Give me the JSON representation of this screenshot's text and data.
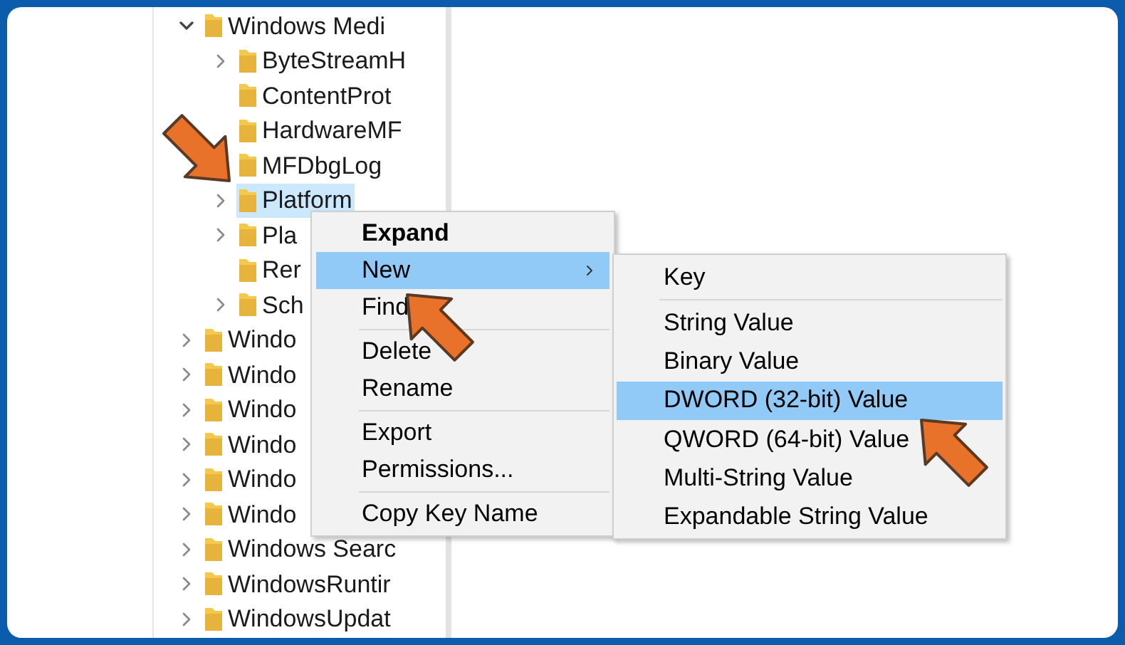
{
  "tree": {
    "items": [
      {
        "label": "Windows Medi",
        "kind": "branch",
        "expanded": true,
        "selected": false,
        "children": [
          {
            "label": "ByteStreamH",
            "kind": "branch",
            "expanded": false,
            "selected": false
          },
          {
            "label": "ContentProt",
            "kind": "leaf",
            "selected": false
          },
          {
            "label": "HardwareMF",
            "kind": "leaf",
            "selected": false
          },
          {
            "label": "MFDbgLog",
            "kind": "leaf",
            "selected": false
          },
          {
            "label": "Platform",
            "kind": "branch",
            "expanded": false,
            "selected": true
          },
          {
            "label": "Pla",
            "kind": "branch",
            "expanded": false,
            "selected": false
          },
          {
            "label": "Rer",
            "kind": "leaf",
            "selected": false
          },
          {
            "label": "Sch",
            "kind": "branch",
            "expanded": false,
            "selected": false
          }
        ]
      },
      {
        "label": "Windo",
        "kind": "branch",
        "expanded": false,
        "selected": false
      },
      {
        "label": "Windo",
        "kind": "branch",
        "expanded": false,
        "selected": false
      },
      {
        "label": "Windo",
        "kind": "branch",
        "expanded": false,
        "selected": false
      },
      {
        "label": "Windo",
        "kind": "branch",
        "expanded": false,
        "selected": false
      },
      {
        "label": "Windo",
        "kind": "branch",
        "expanded": false,
        "selected": false
      },
      {
        "label": "Windo",
        "kind": "branch",
        "expanded": false,
        "selected": false
      },
      {
        "label": "Windows Searc",
        "kind": "branch",
        "expanded": false,
        "selected": false
      },
      {
        "label": "WindowsRuntir",
        "kind": "branch",
        "expanded": false,
        "selected": false
      },
      {
        "label": "WindowsUpdat",
        "kind": "branch",
        "expanded": false,
        "selected": false
      }
    ]
  },
  "context_menu": {
    "items": [
      {
        "kind": "item",
        "label": "Expand",
        "bold": true,
        "selected": false,
        "submenu": false
      },
      {
        "kind": "item",
        "label": "New",
        "bold": false,
        "selected": true,
        "submenu": true
      },
      {
        "kind": "item",
        "label": "Find",
        "bold": false,
        "selected": false,
        "submenu": false
      },
      {
        "kind": "separator"
      },
      {
        "kind": "item",
        "label": "Delete",
        "bold": false,
        "selected": false,
        "submenu": false
      },
      {
        "kind": "item",
        "label": "Rename",
        "bold": false,
        "selected": false,
        "submenu": false
      },
      {
        "kind": "separator"
      },
      {
        "kind": "item",
        "label": "Export",
        "bold": false,
        "selected": false,
        "submenu": false
      },
      {
        "kind": "item",
        "label": "Permissions...",
        "bold": false,
        "selected": false,
        "submenu": false
      },
      {
        "kind": "separator"
      },
      {
        "kind": "item",
        "label": "Copy Key Name",
        "bold": false,
        "selected": false,
        "submenu": false
      }
    ]
  },
  "submenu": {
    "items": [
      {
        "kind": "item",
        "label": "Key",
        "selected": false
      },
      {
        "kind": "separator"
      },
      {
        "kind": "item",
        "label": "String Value",
        "selected": false
      },
      {
        "kind": "item",
        "label": "Binary Value",
        "selected": false
      },
      {
        "kind": "item",
        "label": "DWORD (32-bit) Value",
        "selected": true
      },
      {
        "kind": "item",
        "label": "QWORD (64-bit) Value",
        "selected": false
      },
      {
        "kind": "item",
        "label": "Multi-String Value",
        "selected": false
      },
      {
        "kind": "item",
        "label": "Expandable String Value",
        "selected": false
      }
    ]
  }
}
